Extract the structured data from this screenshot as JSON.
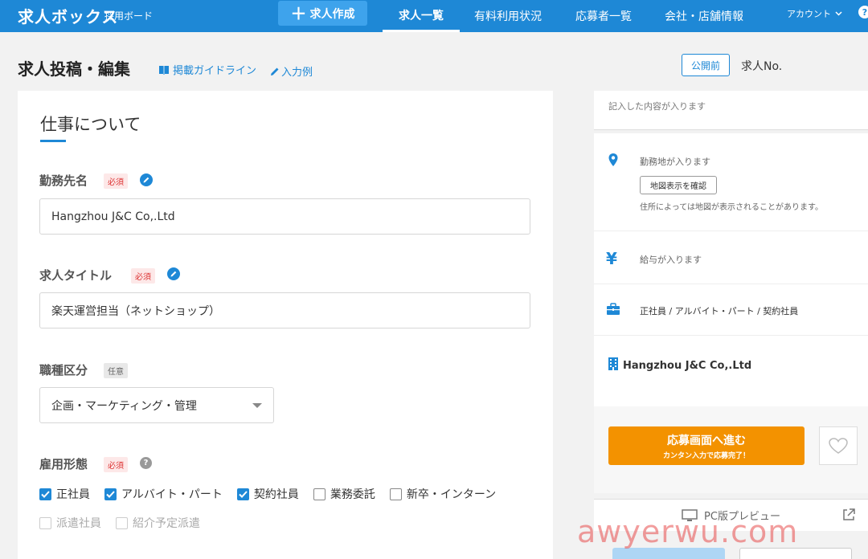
{
  "header": {
    "logo": "求人ボックス",
    "logo_sub": "採用ボード",
    "create_button": "求人作成",
    "nav": [
      "求人一覧",
      "有料利用状況",
      "応募者一覧",
      "会社・店舗情報"
    ],
    "account": "アカウント",
    "help": "?"
  },
  "titlebar": {
    "title": "求人投稿・編集",
    "guide_link": "掲載ガイドライン",
    "example_link": "入力例",
    "status_badge": "公開前",
    "job_no": "求人No."
  },
  "form": {
    "section_title": "仕事について",
    "company_label": "勤務先名",
    "company_required": "必須",
    "company_value": "Hangzhou J&C Co,.Ltd",
    "title_label": "求人タイトル",
    "title_required": "必須",
    "title_value": "楽天運営担当（ネットショップ）",
    "category_label": "職種区分",
    "category_optional": "任意",
    "category_value": "企画・マーケティング・管理",
    "employment_label": "雇用形態",
    "employment_required": "必須",
    "employment_types": [
      {
        "label": "正社員",
        "checked": true
      },
      {
        "label": "アルバイト・パート",
        "checked": true
      },
      {
        "label": "契約社員",
        "checked": true
      },
      {
        "label": "業務委託",
        "checked": false
      },
      {
        "label": "新卒・インターン",
        "checked": false
      }
    ],
    "employment_types_disabled": [
      {
        "label": "派遣社員"
      },
      {
        "label": "紹介予定派遣"
      }
    ]
  },
  "preview": {
    "placeholder_top": "記入した内容が入ります",
    "location_placeholder": "勤務地が入ります",
    "map_button": "地図表示を確認",
    "map_note": "住所によっては地図が表示されることがあります。",
    "salary_placeholder": "給与が入ります",
    "employment_summary": "正社員 / アルバイト・パート / 契約社員",
    "company_name": "Hangzhou J&C Co,.Ltd",
    "apply_main": "応募画面へ進む",
    "apply_sub": "カンタン入力で応募完了！",
    "pc_preview": "PC版プレビュー"
  },
  "watermark": "awyerwu.com",
  "colors": {
    "brand": "#1e88d6",
    "apply": "#f39200",
    "required": "#d33333"
  }
}
